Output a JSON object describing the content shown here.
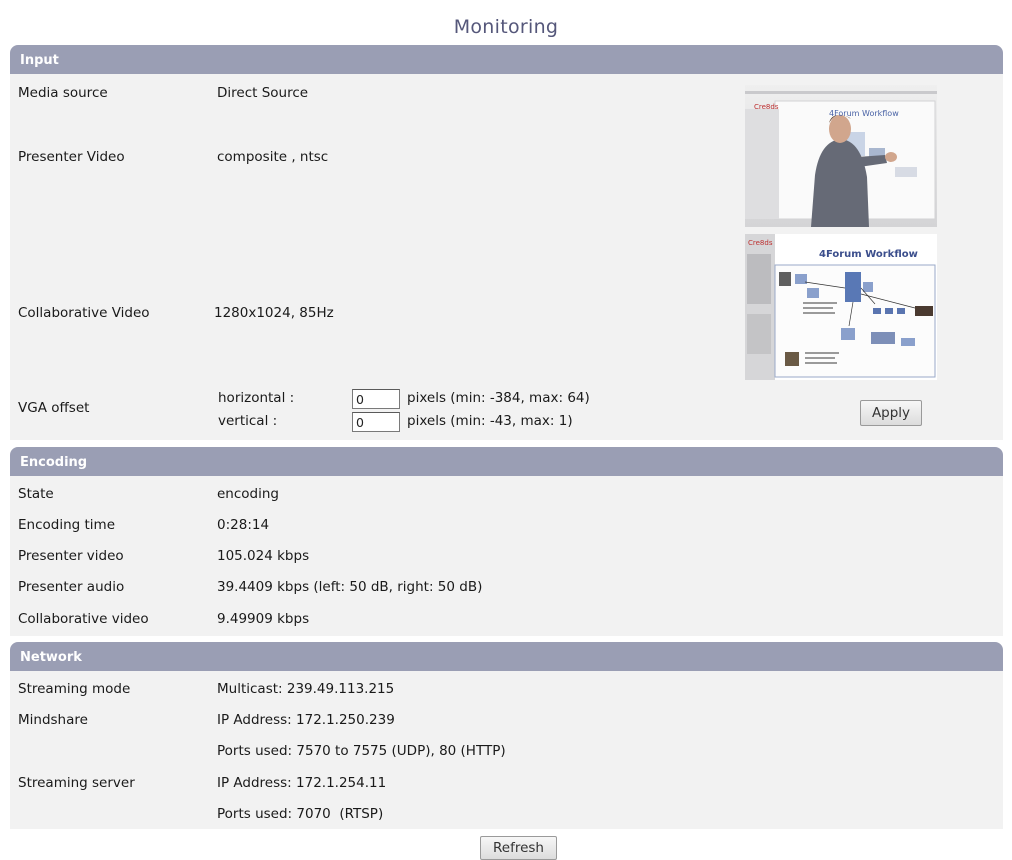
{
  "page": {
    "title": "Monitoring"
  },
  "input": {
    "header": "Input",
    "media_source": {
      "label": "Media source",
      "value": "Direct Source"
    },
    "presenter_video": {
      "label": "Presenter Video",
      "value": "composite , ntsc"
    },
    "collaborative_video": {
      "label": "Collaborative Video",
      "value": "1280x1024, 85Hz"
    },
    "vga_offset": {
      "label": "VGA offset",
      "horizontal": {
        "label": "horizontal :",
        "value": "0",
        "range": "pixels (min: -384, max: 64)"
      },
      "vertical": {
        "label": "vertical :",
        "value": "0",
        "range": "pixels (min: -43, max: 1)"
      }
    },
    "apply_label": "Apply",
    "collab_slide_title": "4Forum Workflow",
    "presenter_slide_title": "4Forum Workflow",
    "slide_logo": "Cre8ds"
  },
  "encoding": {
    "header": "Encoding",
    "rows": [
      {
        "label": "State",
        "value": "encoding"
      },
      {
        "label": "Encoding time",
        "value": "0:28:14"
      },
      {
        "label": "Presenter video",
        "value": "105.024 kbps"
      },
      {
        "label": "Presenter audio",
        "value": "39.4409 kbps (left: 50 dB, right: 50 dB)"
      },
      {
        "label": "Collaborative video",
        "value": "9.49909 kbps"
      }
    ]
  },
  "network": {
    "header": "Network",
    "rows": [
      {
        "label": "Streaming mode",
        "value": "Multicast: 239.49.113.215"
      },
      {
        "label": "Mindshare",
        "value": "IP Address: 172.1.250.239"
      },
      {
        "label": "",
        "value": "Ports used: 7570 to 7575 (UDP), 80 (HTTP)"
      },
      {
        "label": "Streaming server",
        "value": "IP Address: 172.1.254.11"
      },
      {
        "label": "",
        "value": "Ports used: 7070  (RTSP)"
      }
    ]
  },
  "refresh_label": "Refresh",
  "colors": {
    "section_bar": "#9a9eb4",
    "section_body": "#f2f2f2",
    "title": "#55577a"
  }
}
